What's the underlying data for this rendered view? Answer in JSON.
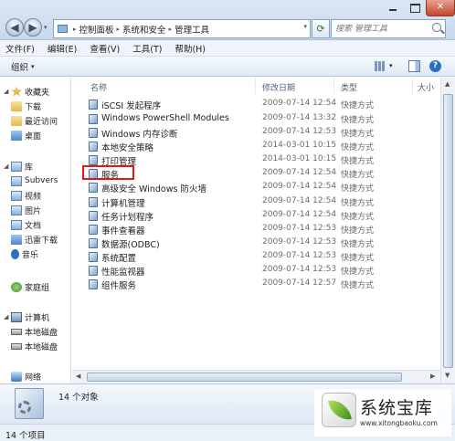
{
  "window": {
    "close_glyph": "✕"
  },
  "address_bar": {
    "crumbs": [
      "控制面板",
      "系统和安全",
      "管理工具"
    ],
    "sep": "▸",
    "drop": "▾",
    "refresh_glyph": "⟳"
  },
  "nav": {
    "back_glyph": "◀",
    "forward_glyph": "▶",
    "drop": "▾"
  },
  "search": {
    "placeholder": "搜索 管理工具"
  },
  "menu": [
    "文件(F)",
    "编辑(E)",
    "查看(V)",
    "工具(T)",
    "帮助(H)"
  ],
  "toolbar": {
    "organize": "组织",
    "caret": "▾",
    "view_caret": "▾",
    "help": "?"
  },
  "sidebar": {
    "items": [
      {
        "label": "收藏夹",
        "icon": "star-icon",
        "arrow": "◢"
      },
      {
        "label": "下载",
        "icon": "downloads-folder-icon"
      },
      {
        "label": "最近访问",
        "icon": "recent-places-icon"
      },
      {
        "label": "桌面",
        "icon": "desktop-icon"
      },
      {
        "label": "库",
        "icon": "libraries-icon",
        "arrow": "◢"
      },
      {
        "label": "Subvers",
        "icon": "subversion-library-icon"
      },
      {
        "label": "视频",
        "icon": "videos-library-icon"
      },
      {
        "label": "图片",
        "icon": "pictures-library-icon"
      },
      {
        "label": "文档",
        "icon": "documents-library-icon"
      },
      {
        "label": "迅雷下载",
        "icon": "thunder-download-icon"
      },
      {
        "label": "音乐",
        "icon": "music-library-icon"
      },
      {
        "label": "家庭组",
        "icon": "homegroup-icon"
      },
      {
        "label": "计算机",
        "icon": "computer-icon",
        "arrow": "◢"
      },
      {
        "label": "本地磁盘",
        "icon": "local-disk-icon"
      },
      {
        "label": "本地磁盘",
        "icon": "local-disk-icon"
      },
      {
        "label": "网络",
        "icon": "network-icon"
      }
    ]
  },
  "columns": {
    "name": "名称",
    "date": "修改日期",
    "type": "类型",
    "size": "大小"
  },
  "files": [
    {
      "name": "iSCSI 发起程序",
      "date": "2009-07-14 12:54",
      "type": "快捷方式",
      "size": ""
    },
    {
      "name": "Windows PowerShell Modules",
      "date": "2009-07-14 13:32",
      "type": "快捷方式",
      "size": ""
    },
    {
      "name": "Windows 内存诊断",
      "date": "2009-07-14 12:53",
      "type": "快捷方式",
      "size": ""
    },
    {
      "name": "本地安全策略",
      "date": "2014-03-01 10:15",
      "type": "快捷方式",
      "size": ""
    },
    {
      "name": "打印管理",
      "date": "2014-03-01 10:15",
      "type": "快捷方式",
      "size": ""
    },
    {
      "name": "服务",
      "date": "2009-07-14 12:54",
      "type": "快捷方式",
      "size": ""
    },
    {
      "name": "高级安全 Windows 防火墙",
      "date": "2009-07-14 12:54",
      "type": "快捷方式",
      "size": ""
    },
    {
      "name": "计算机管理",
      "date": "2009-07-14 12:54",
      "type": "快捷方式",
      "size": ""
    },
    {
      "name": "任务计划程序",
      "date": "2009-07-14 12:54",
      "type": "快捷方式",
      "size": ""
    },
    {
      "name": "事件查看器",
      "date": "2009-07-14 12:53",
      "type": "快捷方式",
      "size": ""
    },
    {
      "name": "数据源(ODBC)",
      "date": "2009-07-14 12:53",
      "type": "快捷方式",
      "size": ""
    },
    {
      "name": "系统配置",
      "date": "2009-07-14 12:53",
      "type": "快捷方式",
      "size": ""
    },
    {
      "name": "性能监视器",
      "date": "2009-07-14 12:53",
      "type": "快捷方式",
      "size": ""
    },
    {
      "name": "组件服务",
      "date": "2009-07-14 12:57",
      "type": "快捷方式",
      "size": ""
    }
  ],
  "scroll": {
    "up": "▲",
    "down": "▼",
    "left": "◀",
    "right": "▶"
  },
  "details": {
    "count": "14 个对象"
  },
  "status": {
    "text": "14 个项目"
  },
  "watermark": {
    "title": "系统宝库",
    "url": "www.xitongbaoku.com"
  },
  "colors": {
    "highlight": "#e01818",
    "accent": "#2a6fc4"
  }
}
